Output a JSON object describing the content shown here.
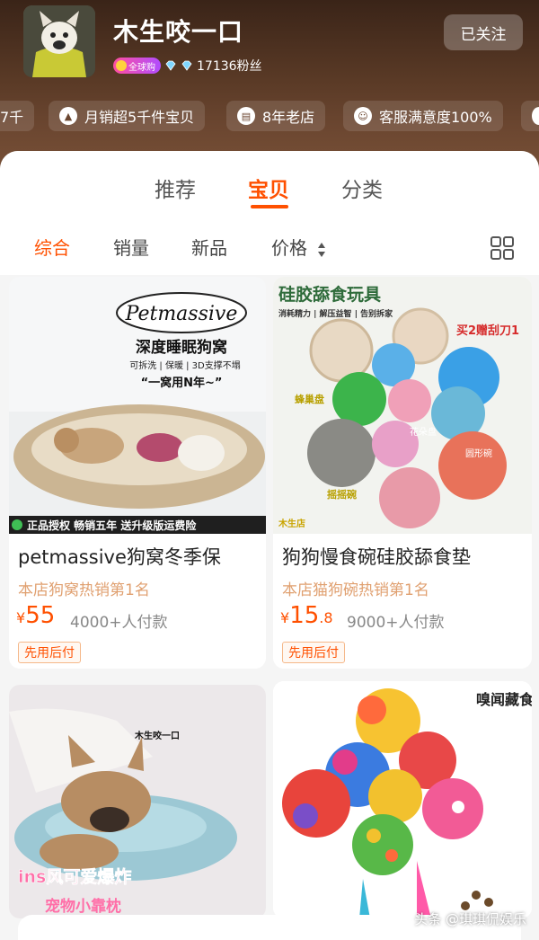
{
  "shop": {
    "name": "木生咬一口",
    "global_badge": "全球购",
    "fans": "17136粉丝",
    "follow_label": "已关注"
  },
  "tags": [
    {
      "label": "7千"
    },
    {
      "label": "月销超5千件宝贝"
    },
    {
      "label": "8年老店"
    },
    {
      "label": "客服满意度100%"
    }
  ],
  "main_tabs": [
    {
      "label": "推荐"
    },
    {
      "label": "宝贝"
    },
    {
      "label": "分类"
    }
  ],
  "sort_tabs": [
    {
      "label": "综合"
    },
    {
      "label": "销量"
    },
    {
      "label": "新品"
    },
    {
      "label": "价格"
    }
  ],
  "products": [
    {
      "img_brand": "Petmassive",
      "img_headline": "深度睡眠狗窝",
      "img_features": "可拆洗 | 保暖 | 3D支撑不塌",
      "img_slogan": "“一窝用N年~”",
      "img_banner": "正品授权 畅销五年 送升级版运费险",
      "title": "petmassive狗窝冬季保",
      "subtitle": "本店狗窝热销第1名",
      "currency": "¥",
      "price_main": "55",
      "price_decimal": "",
      "paid": "4000+人付款",
      "tag": "先用后付"
    },
    {
      "img_headline": "硅胶舔食玩具",
      "img_features": "消耗精力 | 解压益智 | 告别拆家",
      "img_promo": "买2赠刮刀1",
      "img_label1": "蜂巢盘",
      "img_label2": "花朵盘",
      "img_label3": "圆形碗",
      "img_label4": "摇摇碗",
      "img_shop": "木生店",
      "title": "狗狗慢食碗硅胶舔食垫",
      "subtitle": "本店猫狗碗热销第1名",
      "currency": "¥",
      "price_main": "15",
      "price_decimal": ".8",
      "paid": "9000+人付款"
    },
    {
      "img_shop": "木生咬一口",
      "img_headline": "ins风可爱爆炸",
      "img_line2": "宠物小靠枕"
    },
    {
      "img_headline": "嗅闻藏食球"
    }
  ],
  "watermark": "头条 @琪琪侃娱乐",
  "colors": {
    "accent": "#ff5000",
    "header_bg": "#5a3a26"
  }
}
